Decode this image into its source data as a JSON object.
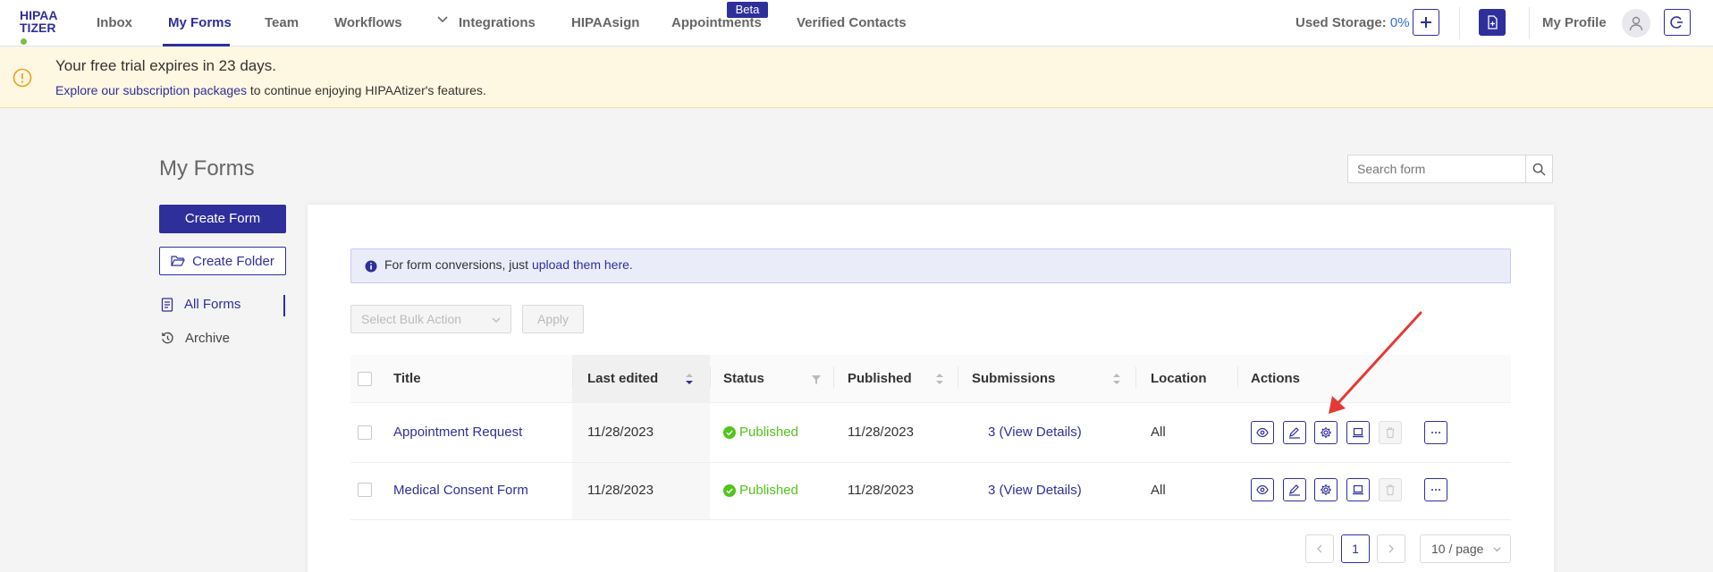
{
  "nav": {
    "logo_line1": "HIPAA",
    "logo_line2": "TIZER",
    "items": [
      "Inbox",
      "My Forms",
      "Team",
      "Workflows",
      "Integrations",
      "HIPAAsign",
      "Appointments",
      "Verified Contacts"
    ],
    "beta_badge": "Beta",
    "storage_label": "Used Storage:",
    "storage_value": "0%",
    "profile_label": "My Profile"
  },
  "banner": {
    "title": "Your free trial expires in 23 days.",
    "link_text": "Explore our subscription packages",
    "rest_text": "to continue enjoying HIPAAtizer's features."
  },
  "page": {
    "title": "My Forms",
    "search_placeholder": "Search form",
    "create_form": "Create Form",
    "create_folder": "Create Folder",
    "sidebar": [
      "All Forms",
      "Archive"
    ]
  },
  "info": {
    "text": "For form conversions, just",
    "link": "upload them here."
  },
  "bulk": {
    "placeholder": "Select Bulk Action",
    "apply": "Apply"
  },
  "table": {
    "headers": [
      "Title",
      "Last edited",
      "Status",
      "Published",
      "Submissions",
      "Location",
      "Actions"
    ],
    "rows": [
      {
        "title": "Appointment Request",
        "last_edited": "11/28/2023",
        "status": "Published",
        "published": "11/28/2023",
        "submissions": "3 (View Details)",
        "location": "All"
      },
      {
        "title": "Medical Consent Form",
        "last_edited": "11/28/2023",
        "status": "Published",
        "published": "11/28/2023",
        "submissions": "3 (View Details)",
        "location": "All"
      }
    ]
  },
  "pagination": {
    "current": "1",
    "page_size": "10 / page"
  },
  "colors": {
    "brand": "#2f2f9c",
    "success": "#52c41a",
    "warning_bg": "#fef7e1",
    "annotation_arrow": "#e53935"
  }
}
